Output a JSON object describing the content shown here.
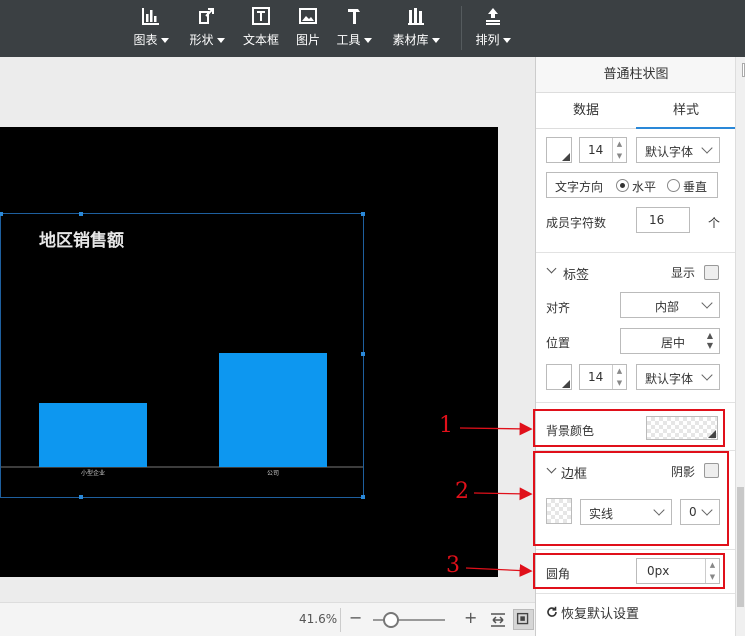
{
  "toolbar": {
    "items": [
      {
        "label": "图表",
        "icon": "bar-chart-icon",
        "has_menu": true
      },
      {
        "label": "形状",
        "icon": "shape-icon",
        "has_menu": true
      },
      {
        "label": "文本框",
        "icon": "textbox-icon",
        "has_menu": false
      },
      {
        "label": "图片",
        "icon": "image-icon",
        "has_menu": false
      },
      {
        "label": "工具",
        "icon": "hammer-icon",
        "has_menu": true
      },
      {
        "label": "素材库",
        "icon": "library-icon",
        "has_menu": true
      },
      {
        "label": "排列",
        "icon": "arrange-icon",
        "has_menu": true
      }
    ]
  },
  "canvas": {
    "background": "#000000",
    "chart": {
      "title": "地区销售额",
      "bar_color": "#0d97f0",
      "chart_data": {
        "type": "bar",
        "categories": [
          "小型企业",
          "公司"
        ],
        "values": [
          32,
          57
        ],
        "title": "地区销售额",
        "xlabel": "",
        "ylabel": "",
        "ylim": [
          0,
          100
        ]
      }
    }
  },
  "statusbar": {
    "zoom": "41.6%",
    "zoom_out": "−",
    "zoom_in": "+",
    "zoom_fraction": 0.25
  },
  "panel": {
    "title": "普通柱状图",
    "tabs": [
      {
        "label": "数据",
        "active": false
      },
      {
        "label": "样式",
        "active": true
      }
    ],
    "font_size_1": "14",
    "font_family_1": "默认字体",
    "text_direction_label": "文字方向",
    "text_direction_options": [
      "水平",
      "垂直"
    ],
    "member_chars_label": "成员字符数",
    "member_chars_value": "16",
    "member_chars_unit": "个",
    "labels_section": "标签",
    "show_label": "显示",
    "align_label": "对齐",
    "align_value": "内部",
    "position_label": "位置",
    "position_value": "居中",
    "font_size_2": "14",
    "font_family_2": "默认字体",
    "bg_color_label": "背景颜色",
    "border_section": "边框",
    "shadow_label": "阴影",
    "border_style": "实线",
    "border_width": "0",
    "radius_label": "圆角",
    "radius_value": "0px",
    "reset_label": "恢复默认设置"
  },
  "annotations": [
    "1",
    "2",
    "3"
  ],
  "colors": {
    "annotation": "#e0101a",
    "accent": "#2a88d8"
  }
}
